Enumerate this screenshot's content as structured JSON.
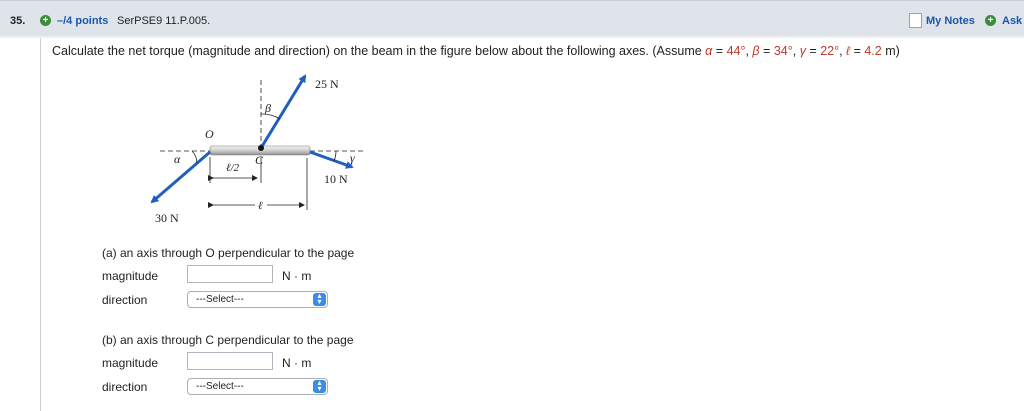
{
  "header": {
    "number": "35.",
    "points": "–/4 points",
    "problem_code": "SerPSE9 11.P.005.",
    "my_notes": "My Notes",
    "ask": "Ask"
  },
  "question": {
    "text": "Calculate the net torque (magnitude and direction) on the beam in the figure below about the following axes. (Assume ",
    "alpha_sym": "α",
    "alpha_val": "44°",
    "beta_sym": "β",
    "beta_val": "34°",
    "gamma_sym": "γ",
    "gamma_val": "22°",
    "ell_sym": "ℓ",
    "ell_val": "4.2",
    "ell_unit": " m)"
  },
  "figure": {
    "force_25": "25 N",
    "force_10": "10 N",
    "force_30": "30 N",
    "label_O": "O",
    "label_C": "C",
    "label_alpha": "α",
    "label_beta": "β",
    "label_gamma": "γ",
    "label_half_ell": "ℓ/2",
    "label_ell": "ℓ"
  },
  "parts": [
    {
      "title": "(a) an axis through O perpendicular to the page",
      "magnitude_label": "magnitude",
      "magnitude_value": "",
      "unit": "N · m",
      "direction_label": "direction",
      "direction_selected": "---Select---"
    },
    {
      "title": "(b) an axis through C perpendicular to the page",
      "magnitude_label": "magnitude",
      "magnitude_value": "",
      "unit": "N · m",
      "direction_label": "direction",
      "direction_selected": "---Select---"
    }
  ],
  "colors": {
    "link": "#1a57b0",
    "variable": "#c0392b",
    "arrow": "#1f5fbf",
    "header_bg": "#dfe4ea"
  }
}
